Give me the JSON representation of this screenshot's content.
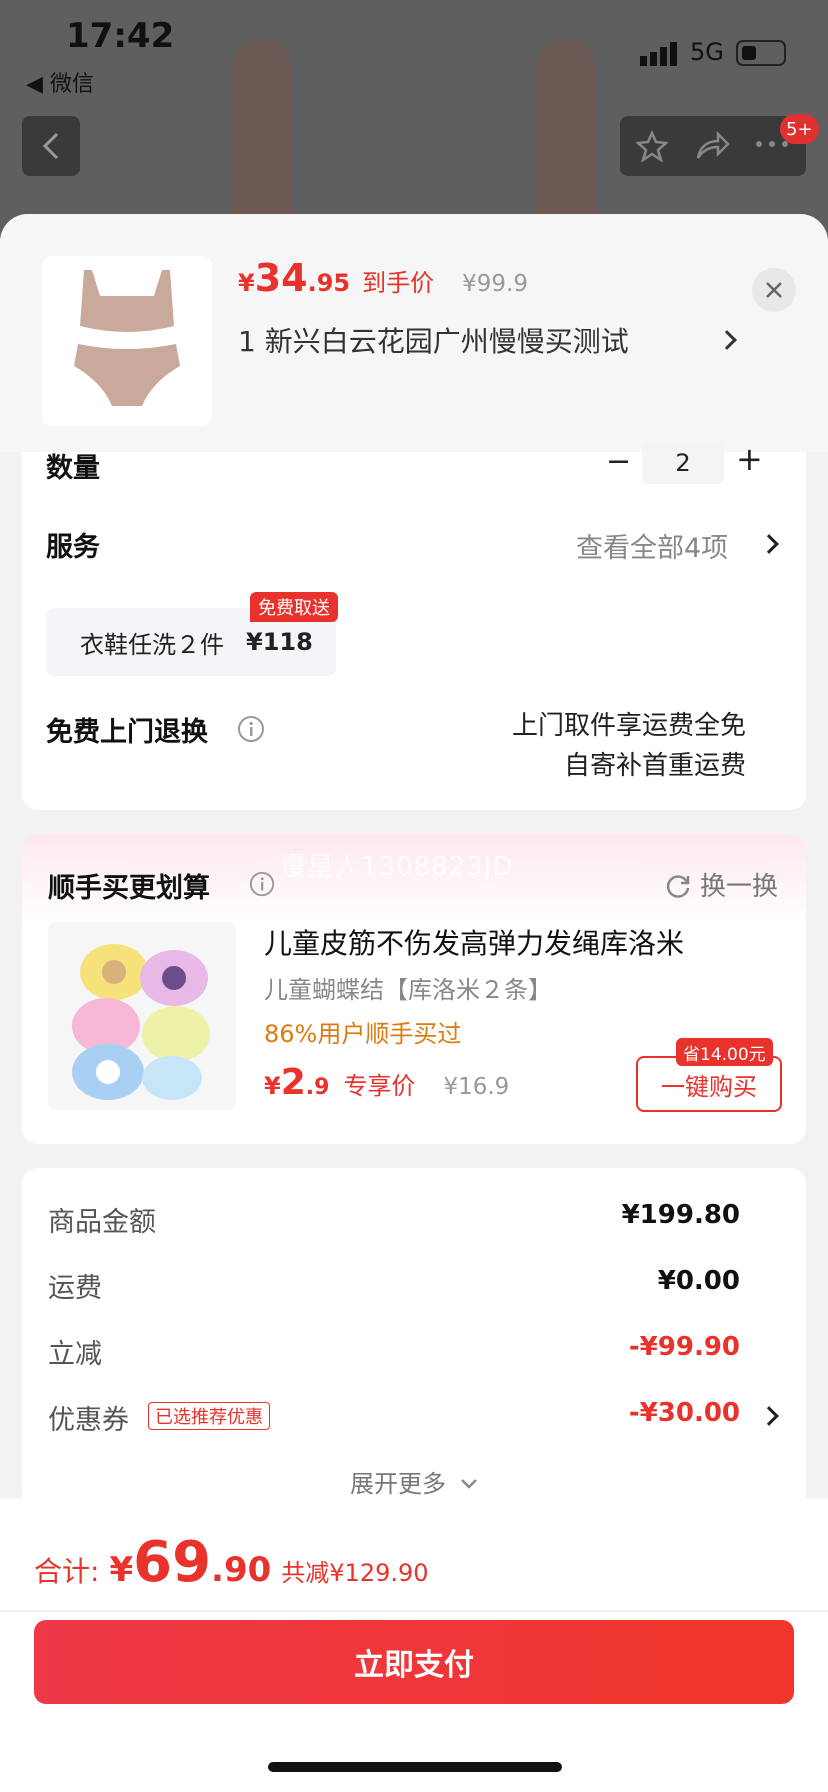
{
  "status_bar": {
    "time": "17:42",
    "back_app": "◀ 微信",
    "network": "5G"
  },
  "top_nav": {
    "badge": "5+"
  },
  "header": {
    "price_symbol": "¥",
    "price_int": "34",
    "price_dec": ".95",
    "price_label": "到手价",
    "original_price": "¥99.9",
    "address": "1 新兴白云花园广州慢慢买测试"
  },
  "quantity": {
    "label": "数量",
    "value": "2",
    "minus": "−",
    "plus": "+"
  },
  "service": {
    "label": "服务",
    "view_all": "查看全部4项",
    "chip_text": "衣鞋任洗２件",
    "chip_price": "¥118",
    "chip_tag": "免费取送"
  },
  "return": {
    "label": "免费上门退换",
    "line1": "上门取件享运费全免",
    "line2": "自寄补首重运费"
  },
  "combo": {
    "watermark": "慢星人1308823JD",
    "title": "顺手买更划算",
    "refresh": "换一换",
    "product_title": "儿童皮筋不伤发高弹力发绳库洛米",
    "product_sub": "儿童蝴蝶结【库洛米２条】",
    "product_rate": "86%用户顺手买过",
    "price_symbol": "¥",
    "price_int": "2",
    "price_dec": ".9",
    "price_label": "专享价",
    "original_price": "¥16.9",
    "buy_button": "一键购买",
    "save_tag": "省14.00元"
  },
  "summary": {
    "rows": [
      {
        "label": "商品金额",
        "value": "¥199.80"
      },
      {
        "label": "运费",
        "value": "¥0.00"
      },
      {
        "label": "立减",
        "value": "-¥99.90"
      },
      {
        "label": "优惠券",
        "value": "-¥30.00"
      }
    ],
    "coupon_tag": "已选推荐优惠",
    "expand": "展开更多"
  },
  "footer": {
    "total_label": "合计:",
    "total_symbol": "¥",
    "total_int": "69",
    "total_dec": ".90",
    "total_saved": "共减¥129.90",
    "pay_button": "立即支付"
  },
  "colors": {
    "accent": "#e8322b",
    "orange": "#e07a10"
  }
}
